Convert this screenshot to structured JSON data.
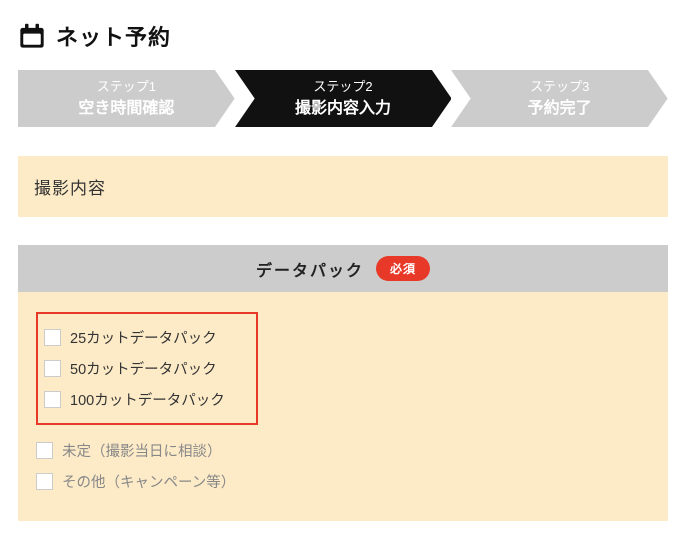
{
  "header": {
    "title": "ネット予約"
  },
  "steps": [
    {
      "small": "ステップ1",
      "large": "空き時間確認",
      "active": false
    },
    {
      "small": "ステップ2",
      "large": "撮影内容入力",
      "active": true
    },
    {
      "small": "ステップ3",
      "large": "予約完了",
      "active": false
    }
  ],
  "section": {
    "title": "撮影内容"
  },
  "group": {
    "label": "データパック",
    "badge": "必須"
  },
  "options_highlight": [
    "25カットデータパック",
    "50カットデータパック",
    "100カットデータパック"
  ],
  "options_rest": [
    {
      "label": "未定（撮影当日に相談）",
      "muted": true
    },
    {
      "label": "その他（キャンペーン等）",
      "muted": true
    }
  ],
  "colors": {
    "inactive": "#cccccc",
    "active": "#111111",
    "accent": "#e83828",
    "panel": "#fdebc8"
  }
}
